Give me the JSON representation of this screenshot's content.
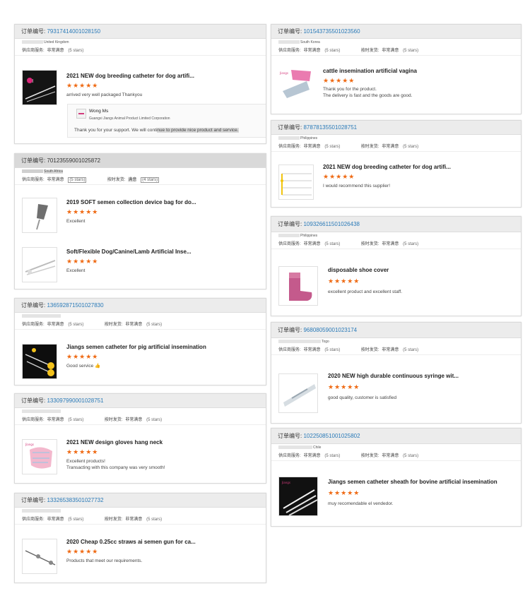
{
  "labels": {
    "order_no": "订单编号:",
    "supplier_service": "供应商服务:",
    "on_time_delivery": "按时发货:",
    "very_satisfied": "非常满意",
    "satisfied": "满意"
  },
  "stars_glyphs": "★★★★★",
  "colors": {
    "star": "#ef6a14",
    "order_link": "#2a7ab8",
    "header_bg": "#ececec"
  },
  "orders": [
    {
      "order_id": "79317414001028150",
      "country": "United Kingdom",
      "service_stars": "(5 stars)",
      "delivery_label": "",
      "delivery_stars": "",
      "items": [
        {
          "name": "2021 NEW dog breeding catheter for dog artifi...",
          "rating": 5,
          "comment": "arrived very well packaged  Thankyou",
          "comment2": ""
        }
      ],
      "reply": {
        "name": "Wong Ms",
        "company": "Guangxi Jiangs Animal Product Limited Corporation",
        "text_a": "Thank you for your support. We will conti",
        "text_b": "nue to provide nice product and service."
      }
    },
    {
      "order_id": "70123559001025872",
      "country": "South Africa",
      "service_stars": "(5 stars)",
      "delivery_value": "满意",
      "delivery_stars": "(4 stars)",
      "items": [
        {
          "name": "2019 SOFT semen collection device bag for do...",
          "rating": 5,
          "comment": "Excellent",
          "comment2": ""
        },
        {
          "name": "Soft/Flexible Dog/Canine/Lamb Artificial Inse...",
          "rating": 5,
          "comment": "Excellent",
          "comment2": ""
        }
      ]
    },
    {
      "order_id": "136592871501027830",
      "country": "",
      "service_stars": "(5 stars)",
      "delivery_value": "非常满意",
      "delivery_stars": "(5 stars)",
      "items": [
        {
          "name": "Jiangs semen catheter for pig artificial insemination",
          "rating": 5,
          "comment": "Good service 👍",
          "comment2": ""
        }
      ]
    },
    {
      "order_id": "133097990001028751",
      "country": "",
      "service_stars": "(5 stars)",
      "delivery_value": "非常满意",
      "delivery_stars": "(5 stars)",
      "items": [
        {
          "name": "2021 NEW design gloves hang neck",
          "rating": 5,
          "comment": "Excellent products!",
          "comment2": "Transacting with this company was very smooth!"
        }
      ]
    },
    {
      "order_id": "133265383501027732",
      "country": "",
      "service_stars": "(5 stars)",
      "delivery_value": "非常满意",
      "delivery_stars": "(5 stars)",
      "items": [
        {
          "name": "2020 Cheap 0.25cc straws ai semen gun for ca...",
          "rating": 5,
          "comment": "Products that meet our requirements.",
          "comment2": ""
        }
      ]
    },
    {
      "order_id": "101543735501023560",
      "country": "South Korea",
      "service_stars": "(5 stars)",
      "delivery_value": "非常满意",
      "delivery_stars": "(5 stars)",
      "items": [
        {
          "name": "cattle insemination artificial vagina",
          "rating": 5,
          "comment": "Thank you for the product.",
          "comment2": "The delivery is fast and the goods are good."
        }
      ]
    },
    {
      "order_id": "87878135501028751",
      "country": "Philippines",
      "service_stars": "(5 stars)",
      "delivery_value": "非常满意",
      "delivery_stars": "(5 stars)",
      "items": [
        {
          "name": "2021 NEW dog breeding catheter for dog artifi...",
          "rating": 5,
          "comment": "I would recommend this supplier!",
          "comment2": ""
        }
      ]
    },
    {
      "order_id": "109326611501026438",
      "country": "Philippines",
      "service_stars": "(5 stars)",
      "delivery_value": "非常满意",
      "delivery_stars": "(5 stars)",
      "items": [
        {
          "name": "disposable shoe cover",
          "rating": 5,
          "comment": "excellent product and excellent staff.",
          "comment2": ""
        }
      ]
    },
    {
      "order_id": "96808059001023174",
      "country": "Togo",
      "service_stars": "(5 stars)",
      "delivery_value": "非常满意",
      "delivery_stars": "(5 stars)",
      "items": [
        {
          "name": "2020 NEW high durable continuous syringe wit...",
          "rating": 5,
          "comment": "good quality, customer is satisfied",
          "comment2": ""
        }
      ]
    },
    {
      "order_id": "102250851001025802",
      "country": "Chile",
      "service_stars": "(5 stars)",
      "delivery_value": "非常满意",
      "delivery_stars": "(5 stars)",
      "items": [
        {
          "name": "Jiangs semen catheter sheath for bovine artificial insemination",
          "rating": 5,
          "comment": "muy recomendable el vendedor.",
          "comment2": ""
        }
      ]
    }
  ]
}
